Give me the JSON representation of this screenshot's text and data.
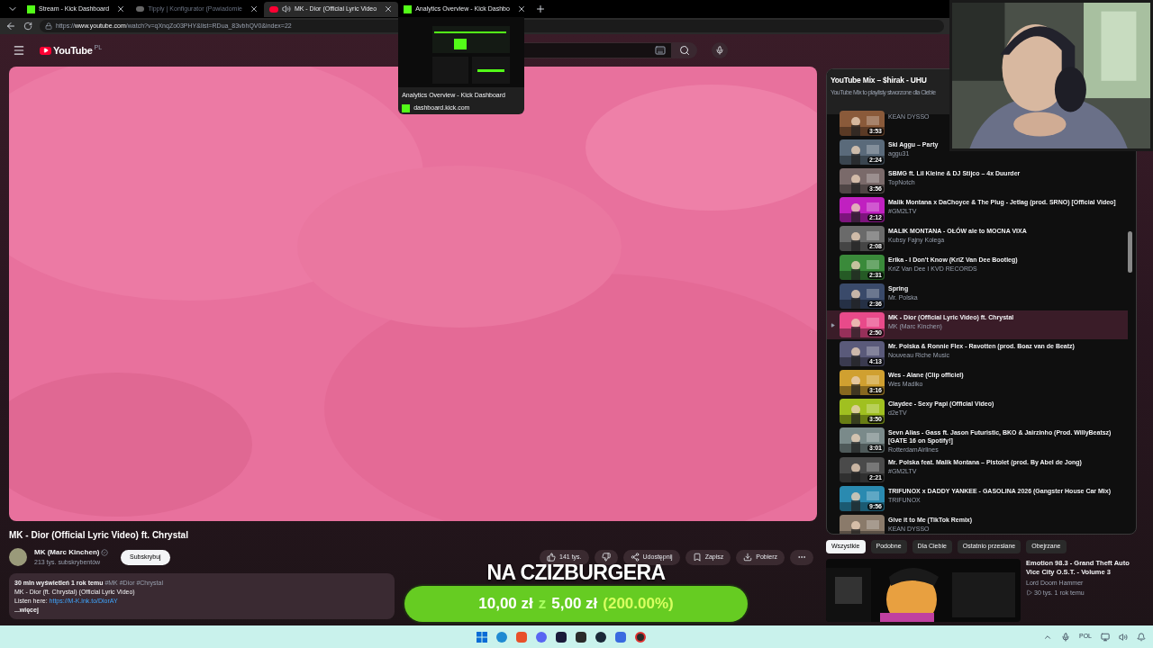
{
  "browser": {
    "tabs": [
      {
        "title": "Stream - Kick Dashboard",
        "kind": "kick",
        "selected": false,
        "dim": false
      },
      {
        "title": "Tipply | Konfigurator (Powiadomie",
        "kind": "tipply",
        "selected": false,
        "dim": true
      },
      {
        "title": "MK - Dior (Official Lyric Video",
        "kind": "youtube",
        "selected": true,
        "dim": false
      },
      {
        "title": "Analytics Overview - Kick Dashbo",
        "kind": "kick",
        "selected": false,
        "dim": false
      }
    ],
    "url_prefix": "https://",
    "url_host": "www.youtube.com",
    "url_path": "/watch?v=qXnqZo03PHY&list=RDua_83vbhQV0&index=22",
    "tab_preview": {
      "title": "Analytics Overview - Kick Dashboard",
      "domain": "dashboard.kick.com"
    }
  },
  "youtube": {
    "logo": "YouTube",
    "region": "PL",
    "video": {
      "title": "MK - Dior (Official Lyric Video) ft. Chrystal",
      "channel": "MK (Marc Kinchen)",
      "subscribers": "213 tys. subskrybentów",
      "subscribe": "Subskrybuj",
      "actions": [
        {
          "kind": "like",
          "label": "141 tys."
        },
        {
          "kind": "dislike"
        },
        {
          "kind": "share",
          "label": "Udostępnij"
        },
        {
          "kind": "save",
          "label": "Zapisz"
        },
        {
          "kind": "download",
          "label": "Pobierz"
        },
        {
          "kind": "more"
        }
      ],
      "description": {
        "stats": "30 mln wyświetleń  1 rok temu",
        "tags": "#MK #Dior #Chrystal",
        "line": "MK - Dior (ft. Chrystal) (Official Lyric Video)",
        "link_label": "Listen here:",
        "link": "https://M-K.lnk.to/DiorAY",
        "more": "...więcej"
      }
    },
    "playlist": {
      "title": "YouTube Mix – $hirak - UHU",
      "subtitle": "YouTube Mix to playlisty stworzone dla Ciebie",
      "items": [
        {
          "channel": "KEAN DYSSO",
          "duration": "3:53",
          "selected": false,
          "color": "#8a5a3a"
        },
        {
          "title": "Ski Aggu – Party",
          "channel": "aggu31",
          "duration": "2:24",
          "selected": false,
          "color": "#5a6a7a"
        },
        {
          "title": "SBMG ft. Lil Kleine & DJ Stijco – 4x Duurder",
          "channel": "TopNotch",
          "duration": "3:56",
          "selected": false,
          "color": "#7a6a6a"
        },
        {
          "title": "Malik Montana x DaChoyce & The Plug - Jetlag (prod. SRNO) [Official Video]",
          "channel": "#GM2LTV",
          "duration": "2:12",
          "selected": false,
          "color": "#c020c0"
        },
        {
          "title": "MALIK MONTANA - OŁÓW ale to MOCNA VIXA",
          "channel": "Kubsy Fajny Kolega",
          "duration": "2:08",
          "selected": false,
          "color": "#6a6a6a"
        },
        {
          "title": "Erika - I Don't Know (KriZ Van Dee Bootleg)",
          "channel": "KriZ Van Dee I KVD RECORDS",
          "duration": "2:31",
          "selected": false,
          "color": "#3a8a3a"
        },
        {
          "title": "Spring",
          "channel": "Mr. Polska",
          "duration": "2:36",
          "selected": false,
          "color": "#3a4a6a"
        },
        {
          "title": "MK - Dior (Official Lyric Video) ft. Chrystal",
          "channel": "MK (Marc Kinchen)",
          "duration": "2:50",
          "selected": true,
          "color": "#e84a8a"
        },
        {
          "title": "Mr. Polska & Ronnie Flex - Ravotten (prod. Boaz van de Beatz)",
          "channel": "Nouveau Riche Music",
          "duration": "4:13",
          "selected": false,
          "color": "#5a5a7a"
        },
        {
          "title": "Wes - Alane (Clip officiel)",
          "channel": "Wes Madiko",
          "duration": "3:16",
          "selected": false,
          "color": "#d0a030"
        },
        {
          "title": "Claydee - Sexy Papi (Official Video)",
          "channel": "d2eTV",
          "duration": "3:50",
          "selected": false,
          "color": "#a0c020"
        },
        {
          "title": "Sevn Alias - Gass ft. Jason Futuristic, BKO & Jairzinho (Prod. WillyBeatsz) [GATE 16 on Spotify!]",
          "channel": "RotterdamAirlines",
          "duration": "3:01",
          "selected": false,
          "color": "#7a8a8a"
        },
        {
          "title": "Mr. Polska feat. Malik Montana – Pistolet (prod. By Abel de Jong)",
          "channel": "#GM2LTV",
          "duration": "2:21",
          "selected": false,
          "color": "#4a4a4a"
        },
        {
          "title": "TRIFUNOX x DADDY YANKEE - GASOLINA 2026 (Gangster House Car Mix)",
          "channel": "TRIFUNOX",
          "duration": "9:56",
          "selected": false,
          "color": "#2a8ab0"
        },
        {
          "title": "Give it to Me (TikTok Remix)",
          "channel": "KEAN DYSSO",
          "selected": false,
          "color": "#8a7a6a"
        }
      ]
    },
    "chips": [
      {
        "label": "Wszystkie",
        "selected": true
      },
      {
        "label": "Podobne",
        "selected": false
      },
      {
        "label": "Dla Ciebie",
        "selected": false
      },
      {
        "label": "Ostatnio przesłane",
        "selected": false
      },
      {
        "label": "Obejrzane",
        "selected": false
      }
    ],
    "recommended": {
      "title": "Emotion 98.3 - Grand Theft Auto Vice City O.S.T. - Volume 3",
      "channel": "Lord Doom Hammer",
      "views": "30 tys.",
      "age": "1 rok temu"
    }
  },
  "overlay": {
    "goal_title": "NA CZIZBURGERA",
    "raised": "10,00 zł",
    "sep": "z",
    "goal": "5,00 zł",
    "percent": "(200.00%)",
    "level": 1
  },
  "taskbar": {
    "language": "POL"
  }
}
